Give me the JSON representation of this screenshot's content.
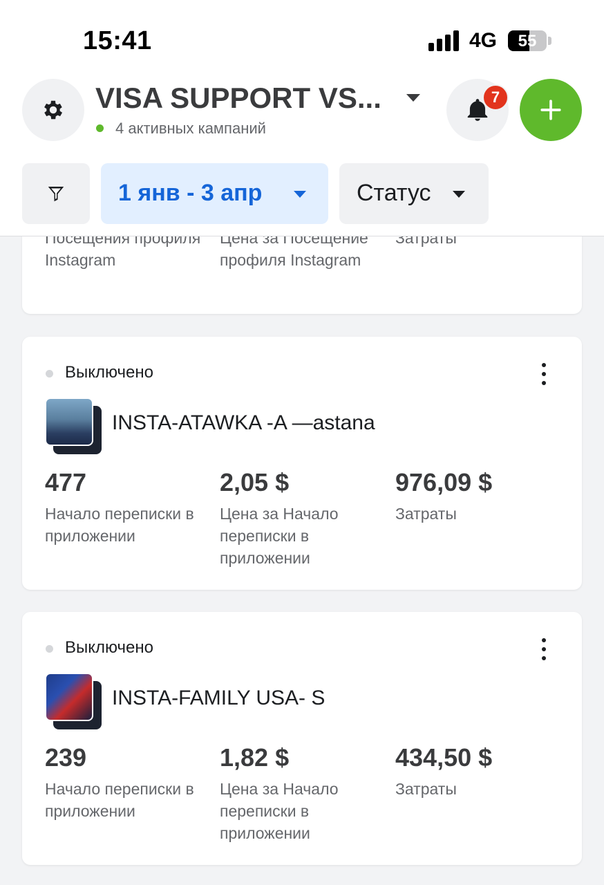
{
  "status_bar": {
    "time": "15:41",
    "network": "4G",
    "battery": "55",
    "battery_level": 0.55
  },
  "header": {
    "title": "VISA SUPPORT VS...",
    "subtitle": "4 активных кампаний",
    "notifications_count": "7",
    "icons": {
      "settings": "gear-icon",
      "bell": "bell-icon",
      "add": "plus-icon",
      "filter": "funnel-icon"
    }
  },
  "filters": {
    "date_range": "1 янв - 3 апр",
    "status": "Статус"
  },
  "partial_card": {
    "labels": [
      "Посещения профиля Instagram",
      "Цена за Посещение профиля Instagram",
      "Затраты"
    ]
  },
  "campaigns": [
    {
      "status": "Выключено",
      "name": "INSTA-ATAWKA -A —astana",
      "metrics": [
        {
          "value": "477",
          "label": "Начало переписки в приложении"
        },
        {
          "value": "2,05 $",
          "label": "Цена за Начало переписки в приложении"
        },
        {
          "value": "976,09 $",
          "label": "Затраты"
        }
      ]
    },
    {
      "status": "Выключено",
      "name": "INSTA-FAMILY USA- S",
      "metrics": [
        {
          "value": "239",
          "label": "Начало переписки в приложении"
        },
        {
          "value": "1,82 $",
          "label": "Цена за Начало переписки в приложении"
        },
        {
          "value": "434,50 $",
          "label": "Затраты"
        }
      ]
    }
  ],
  "colors": {
    "accent_blue": "#1565d8",
    "add_green": "#5fb92c",
    "badge_red": "#e2341d",
    "status_off": "#d5d7da"
  }
}
